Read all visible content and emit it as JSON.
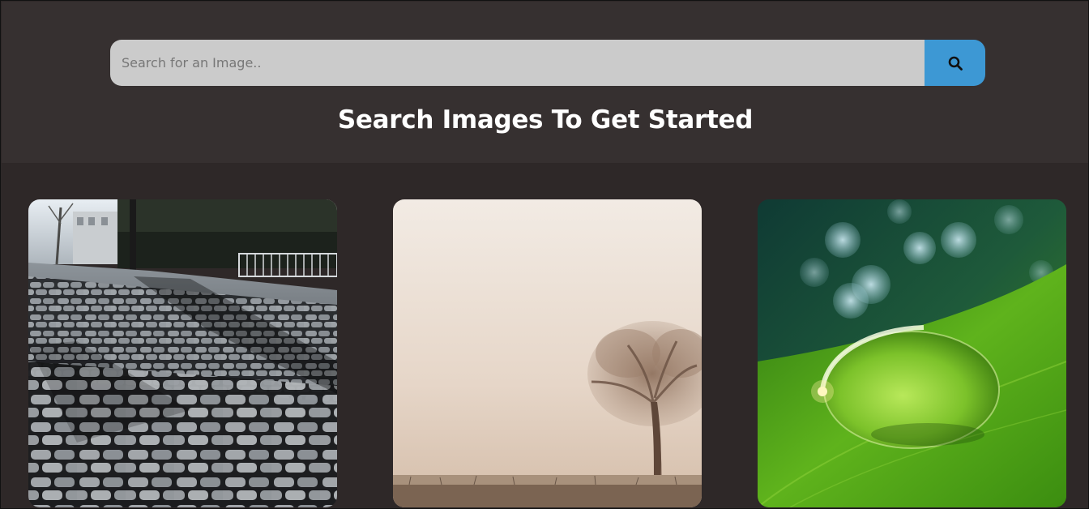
{
  "search": {
    "placeholder": "Search for an Image..",
    "button_icon": "search-icon"
  },
  "heading": "Search Images To Get Started",
  "colors": {
    "header_bg": "#363030",
    "page_bg": "#2e2828",
    "search_bg": "#cbcbcb",
    "button_bg": "#3d98d4"
  },
  "images": [
    {
      "subject": "cobblestone-street"
    },
    {
      "subject": "foggy-tree"
    },
    {
      "subject": "water-drop-on-leaf"
    }
  ]
}
